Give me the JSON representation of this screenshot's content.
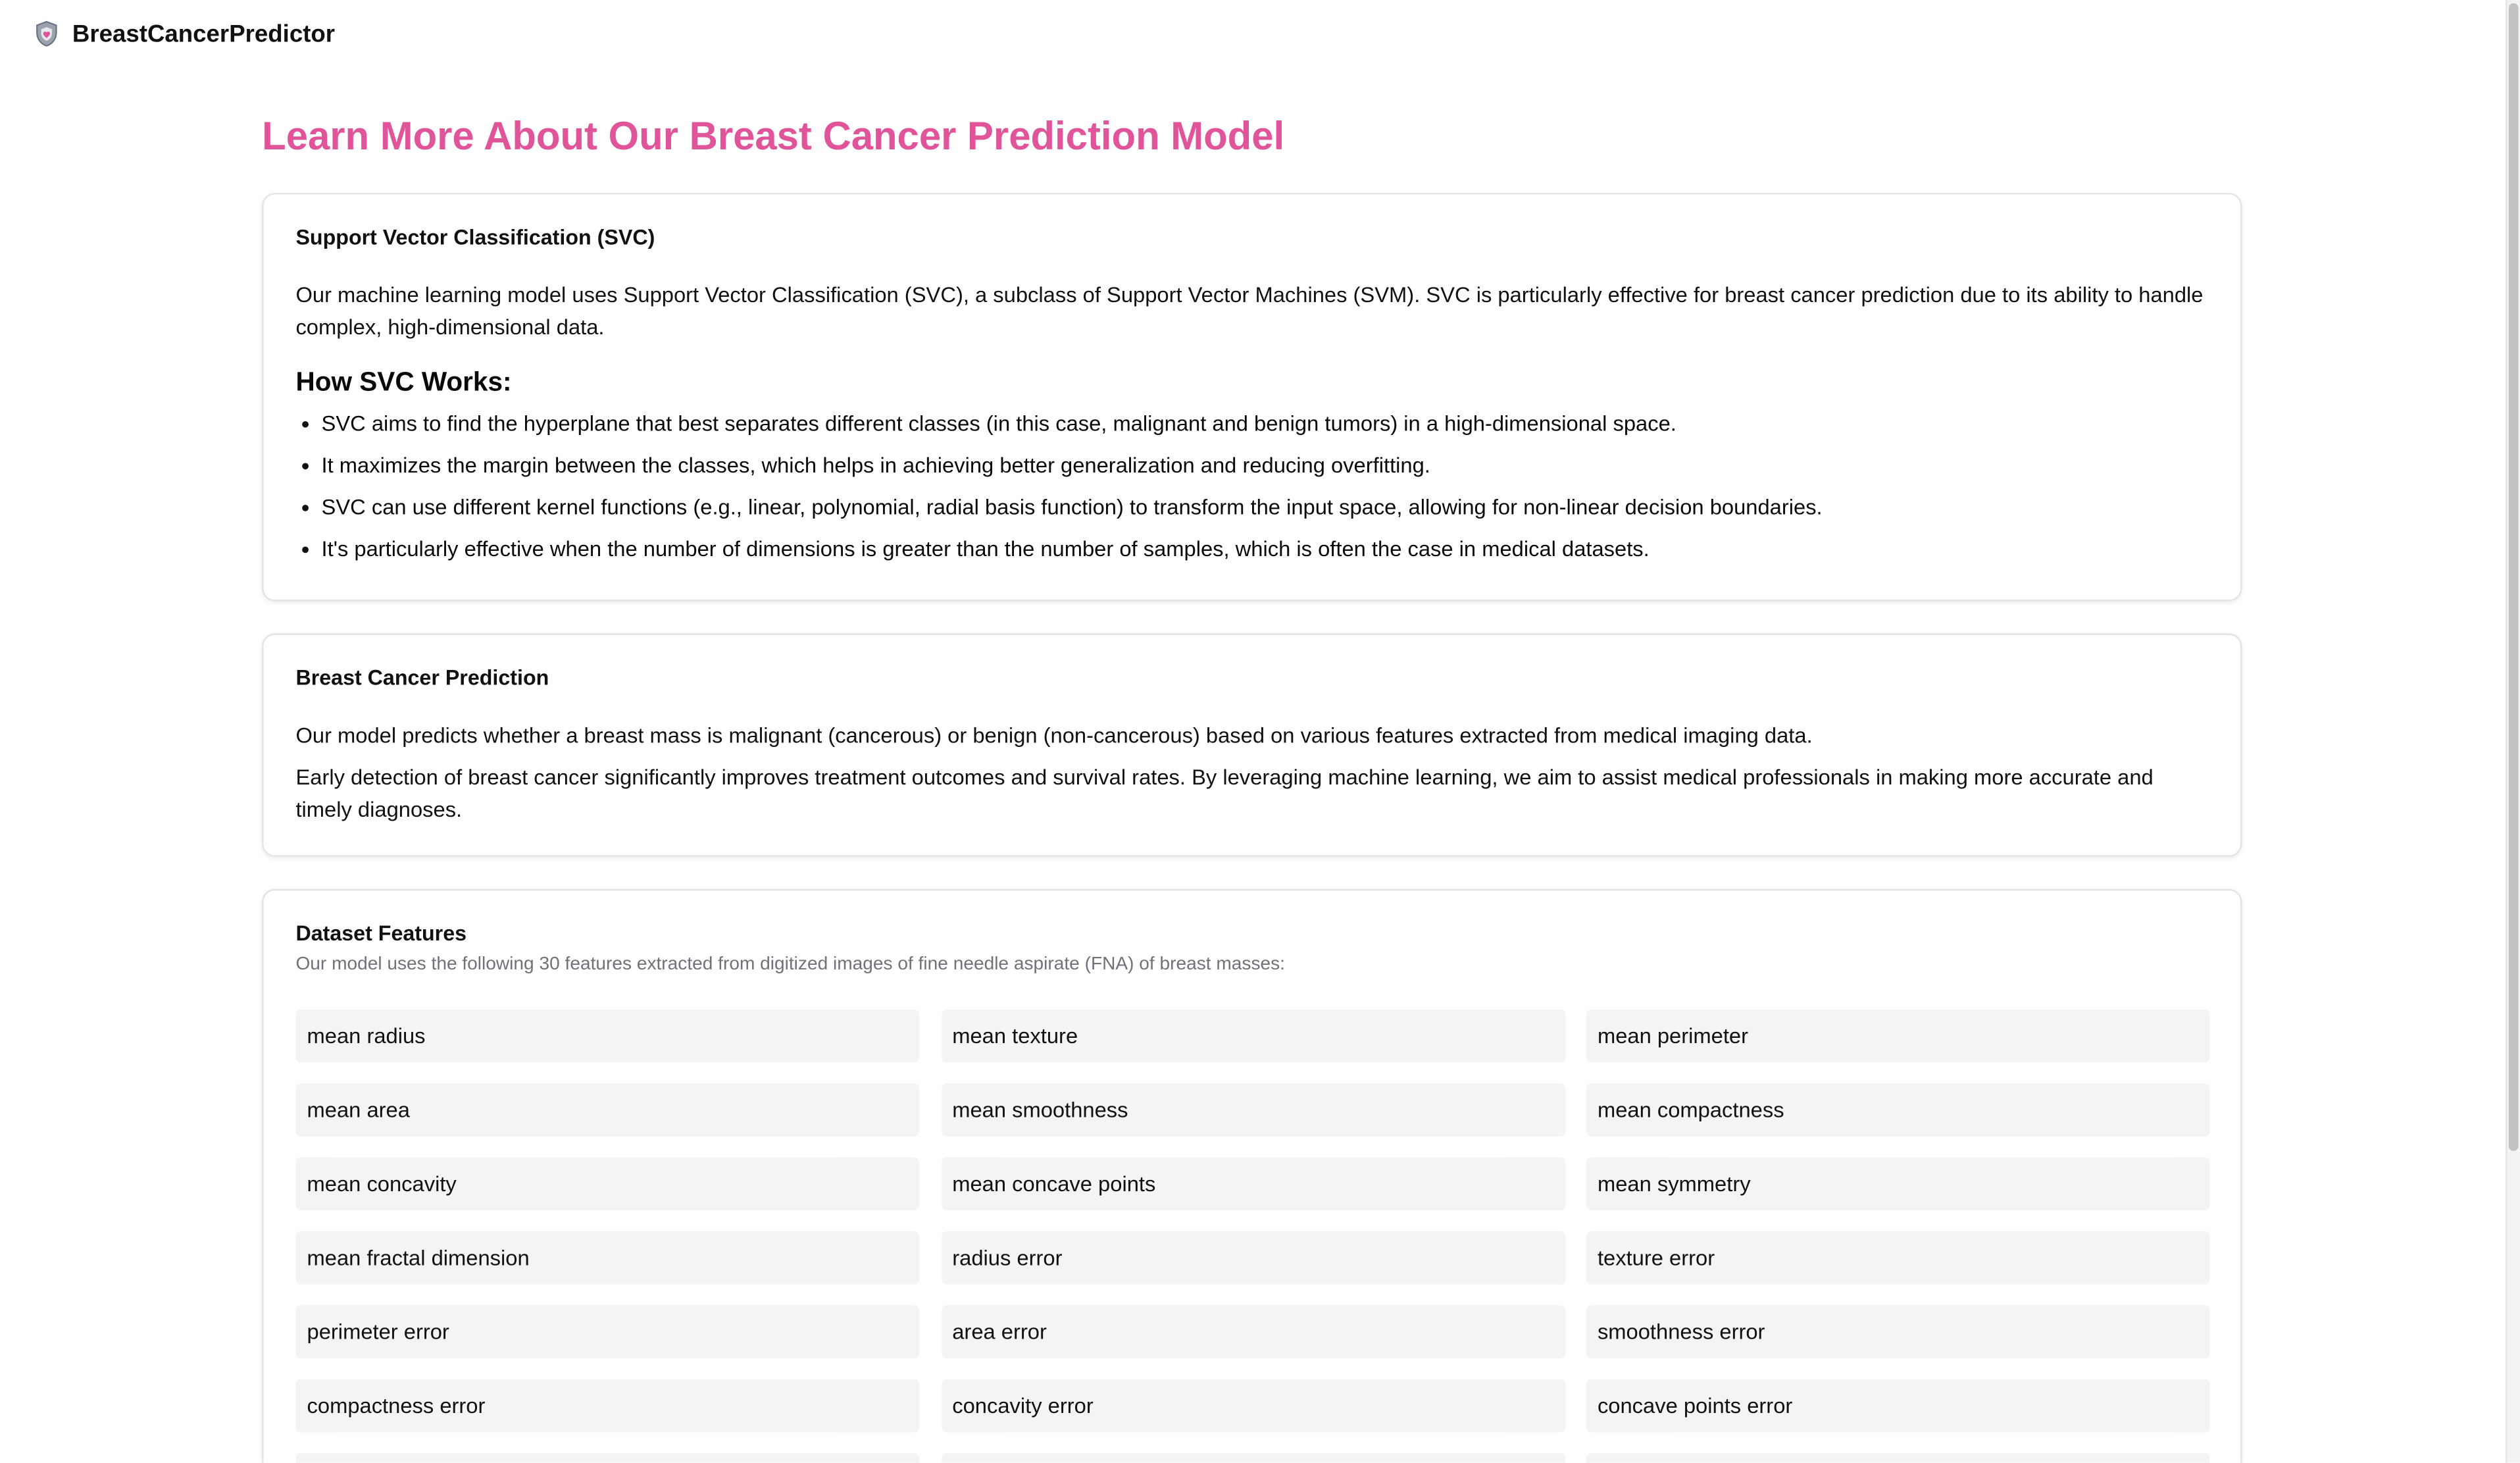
{
  "navbar": {
    "brand": "BreastCancerPredictor",
    "brand_icon": "shield-icon",
    "accent_color": "#e0549a"
  },
  "main": {
    "title": "Learn More About Our Breast Cancer Prediction Model"
  },
  "svc_card": {
    "title": "Support Vector Classification (SVC)",
    "intro": "Our machine learning model uses Support Vector Classification (SVC), a subclass of Support Vector Machines (SVM). SVC is particularly effective for breast cancer prediction due to its ability to handle complex, high-dimensional data.",
    "how_heading": "How SVC Works:",
    "bullets": [
      "SVC aims to find the hyperplane that best separates different classes (in this case, malignant and benign tumors) in a high-dimensional space.",
      "It maximizes the margin between the classes, which helps in achieving better generalization and reducing overfitting.",
      "SVC can use different kernel functions (e.g., linear, polynomial, radial basis function) to transform the input space, allowing for non-linear decision boundaries.",
      "It's particularly effective when the number of dimensions is greater than the number of samples, which is often the case in medical datasets."
    ]
  },
  "prediction_card": {
    "title": "Breast Cancer Prediction",
    "p1": "Our model predicts whether a breast mass is malignant (cancerous) or benign (non-cancerous) based on various features extracted from medical imaging data.",
    "p2": "Early detection of breast cancer significantly improves treatment outcomes and survival rates. By leveraging machine learning, we aim to assist medical professionals in making more accurate and timely diagnoses."
  },
  "dataset_card": {
    "title": "Dataset Features",
    "subtitle": "Our model uses the following 30 features extracted from digitized images of fine needle aspirate (FNA) of breast masses:",
    "features": [
      "mean radius",
      "mean texture",
      "mean perimeter",
      "mean area",
      "mean smoothness",
      "mean compactness",
      "mean concavity",
      "mean concave points",
      "mean symmetry",
      "mean fractal dimension",
      "radius error",
      "texture error",
      "perimeter error",
      "area error",
      "smoothness error",
      "compactness error",
      "concavity error",
      "concave points error"
    ]
  }
}
